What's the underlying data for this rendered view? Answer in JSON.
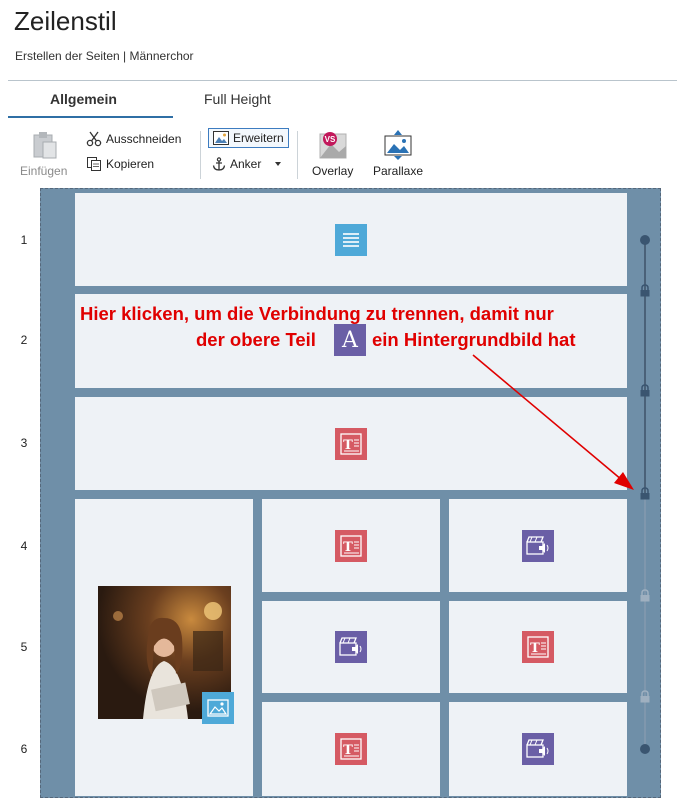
{
  "header": {
    "title": "Zeilenstil",
    "subtitle": "Erstellen der Seiten | Männerchor"
  },
  "tabs": [
    {
      "label": "Allgemein",
      "active": true
    },
    {
      "label": "Full Height",
      "active": false
    }
  ],
  "toolbar": {
    "paste_label": "Einfügen",
    "cut_label": "Ausschneiden",
    "copy_label": "Kopieren",
    "extend_label": "Erweitern",
    "anchor_label": "Anker",
    "overlay_label": "Overlay",
    "overlay_badge": "VS",
    "parallax_label": "Parallaxe"
  },
  "rows": [
    "1",
    "2",
    "3",
    "4",
    "5",
    "6"
  ],
  "annotation": {
    "line1": "Hier klicken, um die Verbindung zu trennen, damit nur",
    "line2a": "der obere Teil",
    "line2b": "ein Hintergrundbild hat",
    "icon_letter": "A",
    "color": "#e00000"
  },
  "colors": {
    "accent": "#2f6fa5",
    "grid_bg": "#6f8fa8",
    "cell_bg": "#eef2f6",
    "text_icon": "#d55a63",
    "video_icon": "#6a5fa6",
    "menu_icon": "#4ea9d8"
  },
  "cells": [
    {
      "row": 1,
      "icon": "menu-icon"
    },
    {
      "row": 2,
      "icon": "none"
    },
    {
      "row": 3,
      "icon": "text-icon"
    },
    {
      "row": "4-6",
      "col": 1,
      "icon": "image-icon"
    },
    {
      "row": 4,
      "col": 2,
      "icon": "text-icon"
    },
    {
      "row": 4,
      "col": 3,
      "icon": "video-icon"
    },
    {
      "row": 5,
      "col": 2,
      "icon": "video-icon"
    },
    {
      "row": 5,
      "col": 3,
      "icon": "text-icon"
    },
    {
      "row": 6,
      "col": 2,
      "icon": "text-icon"
    },
    {
      "row": 6,
      "col": 3,
      "icon": "video-icon"
    }
  ]
}
